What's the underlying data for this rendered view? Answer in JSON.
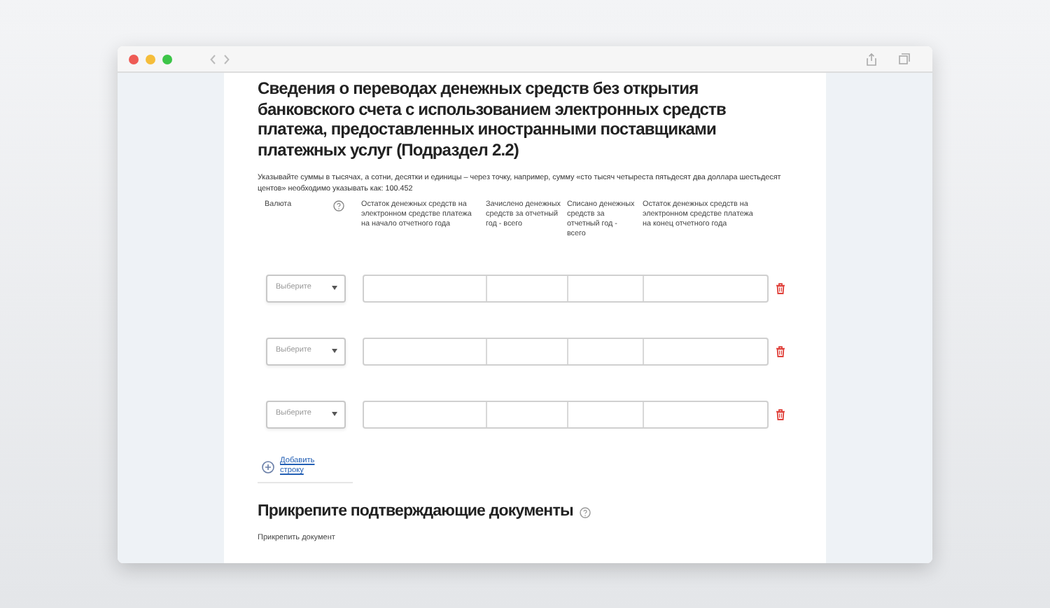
{
  "section": {
    "title": "Сведения о переводах денежных средств без открытия банковского счета с использованием электронных средств платежа, предоставленных иностранными поставщиками платежных услуг (Подраздел 2.2)",
    "note": "Указывайте суммы в тысячах, а сотни, десятки и единицы – через точку, например, сумму «сто тысяч четыреста пятьдесят два доллара шестьдесят центов» необходимо указывать как: 100.452"
  },
  "columns": [
    {
      "label": "Валюта"
    },
    {
      "label": "Остаток денежных средств на электронном средстве платежа на начало отчетного года"
    },
    {
      "label": "Зачислено денежных средств за отчетный год - всего"
    },
    {
      "label": "Списано денежных средств за отчетный год - всего"
    },
    {
      "label": "Остаток денежных средств на электронном средстве платежа на конец отчетного года"
    }
  ],
  "rows": [
    {
      "currency_placeholder": "Выберите"
    },
    {
      "currency_placeholder": "Выберите"
    },
    {
      "currency_placeholder": "Выберите"
    }
  ],
  "add_row": {
    "label": "Добавить строку"
  },
  "attachments": {
    "title": "Прикрепите подтверждающие документы",
    "field_label": "Прикрепить документ"
  }
}
